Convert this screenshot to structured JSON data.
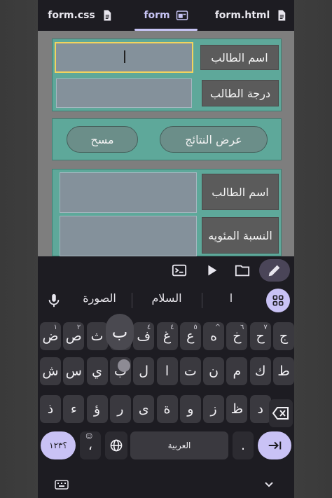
{
  "tabs": [
    {
      "label": "form.css",
      "icon": "file-icon"
    },
    {
      "label": "form",
      "icon": "preview-icon"
    },
    {
      "label": "form.html",
      "icon": "file-icon"
    }
  ],
  "form": {
    "student_name_label": "اسم الطالب",
    "student_grade_label": "درجة الطالب",
    "show_results_button": "عرض النتائج",
    "clear_button": "مسح",
    "result_name_label": "اسم الطالب",
    "result_percent_label": "النسبة المئويه"
  },
  "suggestions": [
    "الصورة",
    "السلام",
    "ا"
  ],
  "keyboard": {
    "row1": [
      {
        "k": "ج",
        "h": ""
      },
      {
        "k": "ح",
        "h": "٧"
      },
      {
        "k": "خ",
        "h": "٦"
      },
      {
        "k": "ه",
        "h": "^"
      },
      {
        "k": "ع",
        "h": "٥"
      },
      {
        "k": "غ",
        "h": "٤"
      },
      {
        "k": "ف",
        "h": "٣"
      },
      {
        "k": "ق",
        "h": "٢"
      },
      {
        "k": "ث",
        "h": "١"
      },
      {
        "k": "ص",
        "h": "٢"
      },
      {
        "k": "ض",
        "h": "١"
      }
    ],
    "row1_ordered": [
      "ض",
      "ص",
      "ث",
      "ق",
      "ف",
      "غ",
      "ع",
      "ه",
      "خ",
      "ح",
      "ج"
    ],
    "row1_hints": [
      "١",
      "٢",
      "",
      "",
      "٤",
      "٤",
      "٥",
      "^",
      "٦",
      "٧",
      ""
    ],
    "popup_key": "ب",
    "row2": [
      "ش",
      "س",
      "ي",
      "ب",
      "ل",
      "ا",
      "ت",
      "ن",
      "م",
      "ك",
      "ط"
    ],
    "row3": [
      "ذ",
      "ء",
      "ؤ",
      "ر",
      "ى",
      "ة",
      "و",
      "ز",
      "ظ",
      "د"
    ],
    "symbols_label": "؟١٢٣",
    "emoji_comma": "،",
    "space_label": "العربية",
    "period_label": ".",
    "colors": {
      "accent": "#c9c2f5",
      "key": "#3a393f",
      "background": "#1d1c22"
    }
  }
}
